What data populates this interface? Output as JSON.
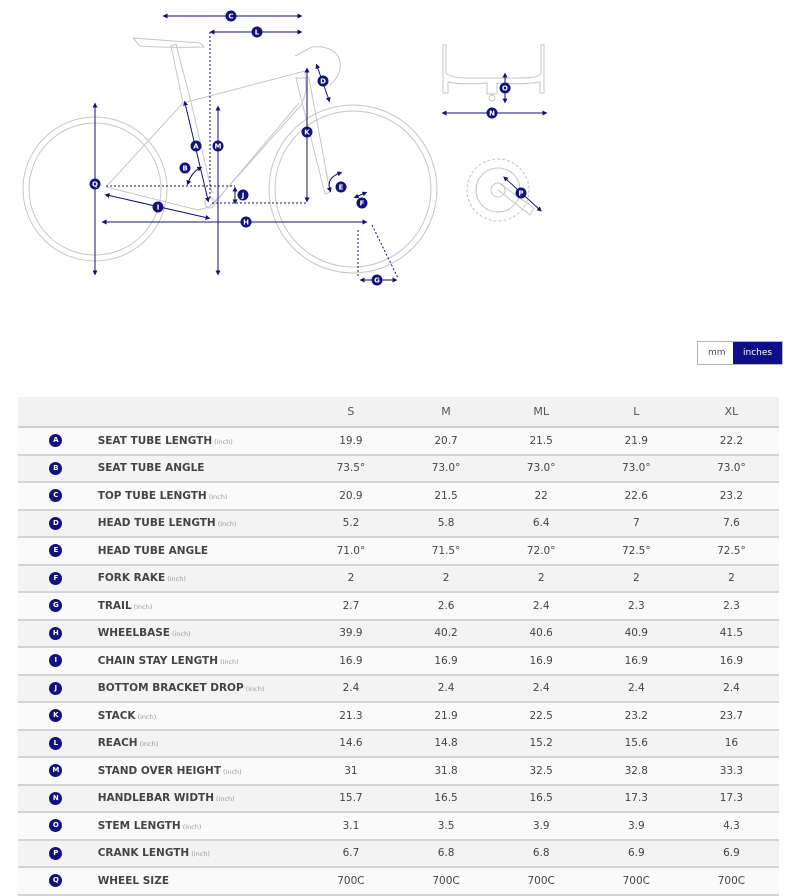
{
  "diagram": {
    "markers": [
      "A",
      "B",
      "C",
      "D",
      "E",
      "F",
      "G",
      "H",
      "I",
      "J",
      "K",
      "L",
      "M",
      "N",
      "O",
      "P",
      "Q"
    ],
    "accent_color": "#12127f",
    "line_color": "#c8c8c8"
  },
  "unit_toggle": {
    "options": [
      {
        "label": "mm",
        "active": false
      },
      {
        "label": "inches",
        "active": true
      }
    ]
  },
  "table": {
    "sizes": [
      "S",
      "M",
      "ML",
      "L",
      "XL"
    ],
    "rows": [
      {
        "key": "A",
        "label": "SEAT TUBE LENGTH",
        "unit": "(inch)",
        "values": [
          "19.9",
          "20.7",
          "21.5",
          "21.9",
          "22.2"
        ]
      },
      {
        "key": "B",
        "label": "SEAT TUBE ANGLE",
        "unit": "",
        "values": [
          "73.5°",
          "73.0°",
          "73.0°",
          "73.0°",
          "73.0°"
        ]
      },
      {
        "key": "C",
        "label": "TOP TUBE LENGTH",
        "unit": "(inch)",
        "values": [
          "20.9",
          "21.5",
          "22",
          "22.6",
          "23.2"
        ]
      },
      {
        "key": "D",
        "label": "HEAD TUBE LENGTH",
        "unit": "(inch)",
        "values": [
          "5.2",
          "5.8",
          "6.4",
          "7",
          "7.6"
        ]
      },
      {
        "key": "E",
        "label": "HEAD TUBE ANGLE",
        "unit": "",
        "values": [
          "71.0°",
          "71.5°",
          "72.0°",
          "72.5°",
          "72.5°"
        ]
      },
      {
        "key": "F",
        "label": "FORK RAKE",
        "unit": "(inch)",
        "values": [
          "2",
          "2",
          "2",
          "2",
          "2"
        ]
      },
      {
        "key": "G",
        "label": "TRAIL",
        "unit": "(inch)",
        "values": [
          "2.7",
          "2.6",
          "2.4",
          "2.3",
          "2.3"
        ]
      },
      {
        "key": "H",
        "label": "WHEELBASE",
        "unit": "(inch)",
        "values": [
          "39.9",
          "40.2",
          "40.6",
          "40.9",
          "41.5"
        ]
      },
      {
        "key": "I",
        "label": "CHAIN STAY LENGTH",
        "unit": "(inch)",
        "values": [
          "16.9",
          "16.9",
          "16.9",
          "16.9",
          "16.9"
        ]
      },
      {
        "key": "J",
        "label": "BOTTOM BRACKET DROP",
        "unit": "(inch)",
        "values": [
          "2.4",
          "2.4",
          "2.4",
          "2.4",
          "2.4"
        ]
      },
      {
        "key": "K",
        "label": "STACK",
        "unit": "(inch)",
        "values": [
          "21.3",
          "21.9",
          "22.5",
          "23.2",
          "23.7"
        ]
      },
      {
        "key": "L",
        "label": "REACH",
        "unit": "(inch)",
        "values": [
          "14.6",
          "14.8",
          "15.2",
          "15.6",
          "16"
        ]
      },
      {
        "key": "M",
        "label": "STAND OVER HEIGHT",
        "unit": "(inch)",
        "values": [
          "31",
          "31.8",
          "32.5",
          "32.8",
          "33.3"
        ]
      },
      {
        "key": "N",
        "label": "HANDLEBAR WIDTH",
        "unit": "(inch)",
        "values": [
          "15.7",
          "16.5",
          "16.5",
          "17.3",
          "17.3"
        ]
      },
      {
        "key": "O",
        "label": "STEM LENGTH",
        "unit": "(inch)",
        "values": [
          "3.1",
          "3.5",
          "3.9",
          "3.9",
          "4.3"
        ]
      },
      {
        "key": "P",
        "label": "CRANK LENGTH",
        "unit": "(inch)",
        "values": [
          "6.7",
          "6.8",
          "6.8",
          "6.9",
          "6.9"
        ]
      },
      {
        "key": "Q",
        "label": "WHEEL SIZE",
        "unit": "",
        "values": [
          "700C",
          "700C",
          "700C",
          "700C",
          "700C"
        ]
      }
    ]
  }
}
